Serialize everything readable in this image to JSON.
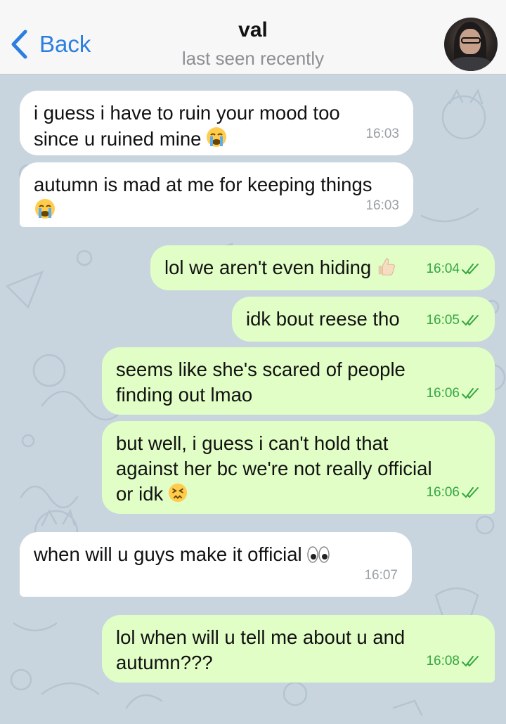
{
  "header": {
    "back_label": "Back",
    "contact_name": "val",
    "status": "last seen recently"
  },
  "theme": {
    "accent": "#2b7fe0",
    "incoming_bubble": "#ffffff",
    "outgoing_bubble": "#e1fec6",
    "outgoing_meta": "#35a642",
    "chat_background": "#c9d5de"
  },
  "messages": [
    {
      "direction": "in",
      "lines": [
        "i guess i have to ruin your mood too",
        "since u ruined mine"
      ],
      "emoji": "loudly-crying-face-icon",
      "time": "16:03"
    },
    {
      "direction": "in",
      "lines": [
        "autumn is mad at me for keeping things",
        ""
      ],
      "emoji": "loudly-crying-face-icon",
      "time": "16:03"
    },
    {
      "direction": "out",
      "lines": [
        "lol we aren't even hiding"
      ],
      "emoji": "thumbs-up-icon",
      "time": "16:04",
      "read": true
    },
    {
      "direction": "out",
      "lines": [
        "idk bout reese tho"
      ],
      "time": "16:05",
      "read": true
    },
    {
      "direction": "out",
      "lines": [
        "seems like she's scared of people",
        "finding out lmao"
      ],
      "time": "16:06",
      "read": true
    },
    {
      "direction": "out",
      "lines": [
        "but well, i guess i can't hold that",
        "against her bc we're not really official",
        "or idk"
      ],
      "emoji": "persevering-face-icon",
      "time": "16:06",
      "read": true
    },
    {
      "direction": "in",
      "lines": [
        "when will u guys make it official"
      ],
      "emoji": "eyes-icon",
      "time": "16:07"
    },
    {
      "direction": "out",
      "lines": [
        "lol when will u tell me about u and",
        "autumn???"
      ],
      "time": "16:08",
      "read": true
    }
  ]
}
